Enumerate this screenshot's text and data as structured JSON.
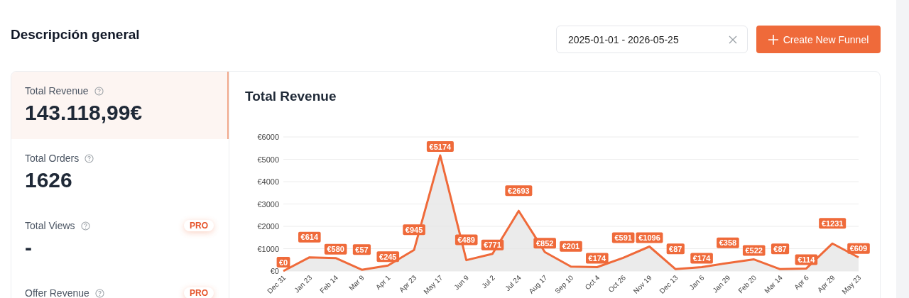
{
  "page": {
    "title": "Descripción general"
  },
  "date_range": {
    "value": "2025-01-01 - 2026-05-25"
  },
  "create_button": {
    "label": "Create New Funnel"
  },
  "metrics": [
    {
      "label": "Total Revenue",
      "value": "143.118,99€",
      "selected": true
    },
    {
      "label": "Total Orders",
      "value": "1626",
      "selected": false
    },
    {
      "label": "Total Views",
      "value": "-",
      "badge": "PRO",
      "selected": false
    },
    {
      "label": "Offer Revenue",
      "badge": "PRO",
      "selected": false
    }
  ],
  "chart": {
    "title": "Total Revenue",
    "chart_data": {
      "type": "line",
      "categories": [
        "Dec 31",
        "Jan 23",
        "Feb 14",
        "Mar 9",
        "Apr 1",
        "Apr 23",
        "May 17",
        "Jun 9",
        "Jul 2",
        "Jul 24",
        "Aug 17",
        "Sep 10",
        "Oct 4",
        "Oct 26",
        "Nov 19",
        "Dec 13",
        "Jan 6",
        "Jan 29",
        "Feb 20",
        "Mar 14",
        "Apr 6",
        "Apr 29",
        "May 23"
      ],
      "grid": true,
      "series": [
        {
          "color": "#ef6a3a",
          "values": [
            0,
            614,
            580,
            57,
            245,
            945,
            5174,
            489,
            771,
            2693,
            852,
            201,
            174,
            591,
            1096,
            87,
            174,
            358,
            522,
            87,
            114,
            1231,
            609
          ]
        }
      ],
      "value_labels": [
        "€0",
        "€614",
        "€580",
        "€57",
        "€245",
        "€945",
        "€5174",
        "€489",
        "€771",
        "€2693",
        "€852",
        "€201",
        "€174",
        "€591",
        "€1096",
        "€87",
        "€174",
        "€358",
        "€522",
        "€87",
        "€114",
        "€1231",
        "€609"
      ],
      "ylim": [
        0,
        6000
      ],
      "yticks": [
        {
          "value": 0,
          "label": "€0"
        },
        {
          "value": 1000,
          "label": "€1000"
        },
        {
          "value": 2000,
          "label": "€2000"
        },
        {
          "value": 3000,
          "label": "€3000"
        },
        {
          "value": 4000,
          "label": "€4000"
        },
        {
          "value": 5000,
          "label": "€5000"
        },
        {
          "value": 6000,
          "label": "€6000"
        }
      ]
    }
  }
}
